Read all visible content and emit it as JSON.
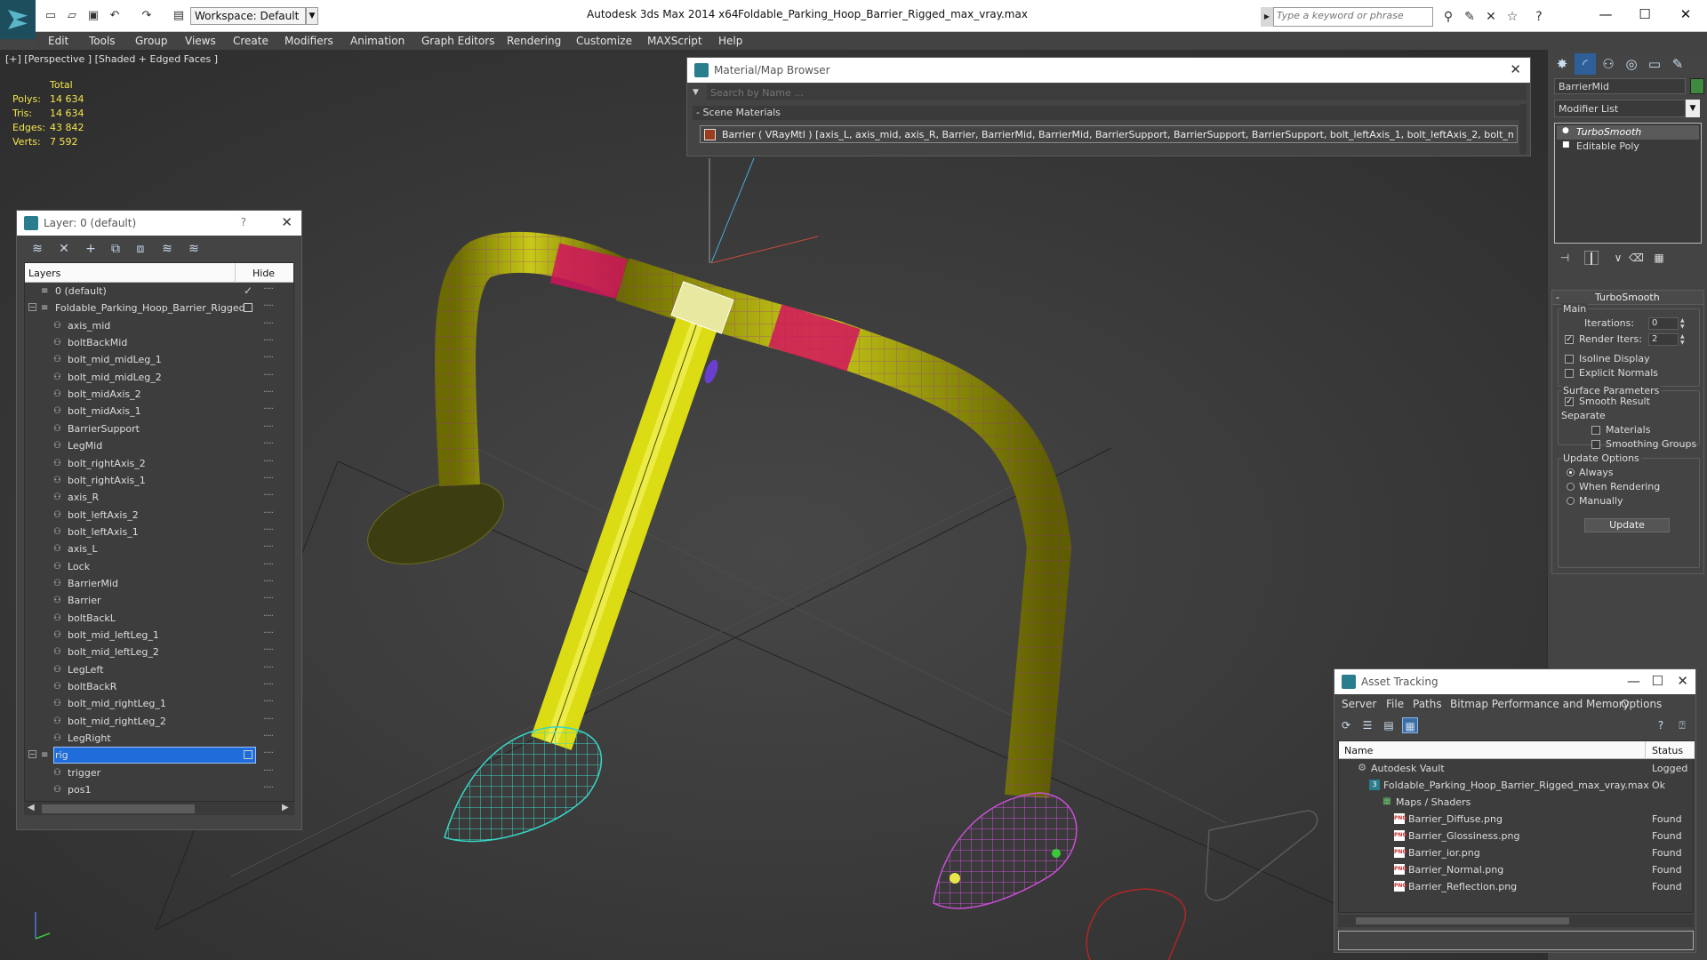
{
  "titlebar": {
    "workspace": "Workspace: Default",
    "app_title": "Autodesk 3ds Max  2014 x64",
    "file_title": "Foldable_Parking_Hoop_Barrier_Rigged_max_vray.max",
    "search_placeholder": "Type a keyword or phrase"
  },
  "menu": [
    "Edit",
    "Tools",
    "Group",
    "Views",
    "Create",
    "Modifiers",
    "Animation",
    "Graph Editors",
    "Rendering",
    "Customize",
    "MAXScript",
    "Help"
  ],
  "viewport": {
    "label": "[+] [Perspective ] [Shaded + Edged Faces ]",
    "stats": {
      "header": "Total",
      "rows": [
        {
          "label": "Polys:",
          "value": "14 634"
        },
        {
          "label": "Tris:",
          "value": "14 634"
        },
        {
          "label": "Edges:",
          "value": "43 842"
        },
        {
          "label": "Verts:",
          "value": "7 592"
        }
      ]
    }
  },
  "layer_panel": {
    "title": "Layer: 0 (default)",
    "help": "?",
    "col_layers": "Layers",
    "col_hide": "Hide",
    "rows": [
      {
        "name": "0 (default)",
        "depth": 1,
        "mark": "check"
      },
      {
        "name": "Foldable_Parking_Hoop_Barrier_Rigged",
        "depth": 1,
        "mark": "box",
        "expander": "−"
      },
      {
        "name": "axis_mid",
        "depth": 2
      },
      {
        "name": "boltBackMid",
        "depth": 2
      },
      {
        "name": "bolt_mid_midLeg_1",
        "depth": 2
      },
      {
        "name": "bolt_mid_midLeg_2",
        "depth": 2
      },
      {
        "name": "bolt_midAxis_2",
        "depth": 2
      },
      {
        "name": "bolt_midAxis_1",
        "depth": 2
      },
      {
        "name": "BarrierSupport",
        "depth": 2
      },
      {
        "name": "LegMid",
        "depth": 2
      },
      {
        "name": "bolt_rightAxis_2",
        "depth": 2
      },
      {
        "name": "bolt_rightAxis_1",
        "depth": 2
      },
      {
        "name": "axis_R",
        "depth": 2
      },
      {
        "name": "bolt_leftAxis_2",
        "depth": 2
      },
      {
        "name": "bolt_leftAxis_1",
        "depth": 2
      },
      {
        "name": "axis_L",
        "depth": 2
      },
      {
        "name": "Lock",
        "depth": 2
      },
      {
        "name": "BarrierMid",
        "depth": 2
      },
      {
        "name": "Barrier",
        "depth": 2
      },
      {
        "name": "boltBackL",
        "depth": 2
      },
      {
        "name": "bolt_mid_leftLeg_1",
        "depth": 2
      },
      {
        "name": "bolt_mid_leftLeg_2",
        "depth": 2
      },
      {
        "name": "LegLeft",
        "depth": 2
      },
      {
        "name": "boltBackR",
        "depth": 2
      },
      {
        "name": "bolt_mid_rightLeg_1",
        "depth": 2
      },
      {
        "name": "bolt_mid_rightLeg_2",
        "depth": 2
      },
      {
        "name": "LegRight",
        "depth": 2
      },
      {
        "name": "rig",
        "depth": 1,
        "mark": "box",
        "selected": true,
        "expander": "−"
      },
      {
        "name": "trigger",
        "depth": 2
      },
      {
        "name": "pos1",
        "depth": 2
      }
    ]
  },
  "material_browser": {
    "title": "Material/Map Browser",
    "search_placeholder": "Search by Name ...",
    "section": "- Scene Materials",
    "entry": "Barrier ( VRayMtl ) [axis_L, axis_mid, axis_R, Barrier, BarrierMid, BarrierMid, BarrierSupport, BarrierSupport, BarrierSupport, bolt_leftAxis_1, bolt_leftAxis_2, bolt_mid_leftLeg..."
  },
  "command_panel": {
    "object_name": "BarrierMid",
    "modifier_list": "Modifier List",
    "stack": [
      "TurboSmooth",
      "Editable Poly"
    ],
    "rollout_title": "TurboSmooth",
    "main_label": "Main",
    "iterations_label": "Iterations:",
    "iterations_value": "0",
    "render_iters_label": "Render Iters:",
    "render_iters_value": "2",
    "isoline_label": "Isoline Display",
    "explicit_label": "Explicit Normals",
    "surface_label": "Surface Parameters",
    "smooth_label": "Smooth Result",
    "separate_label": "Separate",
    "materials_label": "Materials",
    "smoothing_label": "Smoothing Groups",
    "update_options_label": "Update Options",
    "always_label": "Always",
    "when_rendering_label": "When Rendering",
    "manually_label": "Manually",
    "update_button": "Update"
  },
  "asset_tracking": {
    "title": "Asset Tracking",
    "menu": [
      "Server",
      "File",
      "Paths",
      "Bitmap Performance and Memory",
      "Options"
    ],
    "col_name": "Name",
    "col_status": "Status",
    "rows": [
      {
        "name": "Autodesk Vault",
        "status": "Logged",
        "icon": "vault",
        "indent": 20
      },
      {
        "name": "Foldable_Parking_Hoop_Barrier_Rigged_max_vray.max",
        "status": "Ok",
        "icon": "max",
        "indent": 34
      },
      {
        "name": "Maps / Shaders",
        "status": "",
        "icon": "maps",
        "indent": 48
      },
      {
        "name": "Barrier_Diffuse.png",
        "status": "Found",
        "icon": "png",
        "indent": 62
      },
      {
        "name": "Barrier_Glossiness.png",
        "status": "Found",
        "icon": "png",
        "indent": 62
      },
      {
        "name": "Barrier_ior.png",
        "status": "Found",
        "icon": "png",
        "indent": 62
      },
      {
        "name": "Barrier_Normal.png",
        "status": "Found",
        "icon": "png",
        "indent": 62
      },
      {
        "name": "Barrier_Reflection.png",
        "status": "Found",
        "icon": "png",
        "indent": 62
      }
    ]
  }
}
